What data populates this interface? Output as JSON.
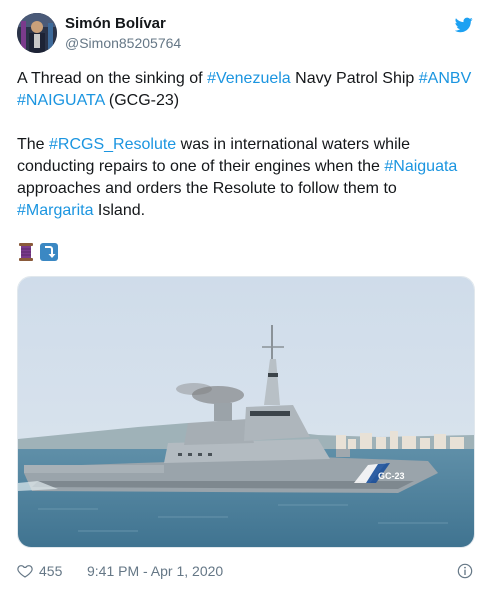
{
  "user": {
    "name": "Simón Bolívar",
    "handle": "@Simon85205764"
  },
  "tweet": {
    "p1": {
      "t1": "A Thread on the sinking of ",
      "tag1": "#Venezuela",
      "t2": " Navy Patrol Ship ",
      "tag2": "#ANBV",
      "t3": " ",
      "tag3": "#NAIGUATA",
      "t4": " (GCG-23)"
    },
    "p2": {
      "t1": "The ",
      "tag1": "#RCGS_Resolute",
      "t2": " was in international waters while conducting repairs to one of their engines when the ",
      "tag2": "#Naiguata",
      "t3": " approaches and orders the Resolute to follow them to ",
      "tag3": "#Margarita",
      "t4": " Island."
    },
    "emojis": [
      "thread-emoji",
      "arrow-heading-down-emoji"
    ]
  },
  "photo": {
    "hull_number": "GC-23"
  },
  "footer": {
    "likes": "455",
    "timestamp": "9:41 PM - Apr 1, 2020"
  },
  "colors": {
    "hashtag": "#1b95e0",
    "brand": "#1da1f2",
    "muted": "#657786"
  }
}
